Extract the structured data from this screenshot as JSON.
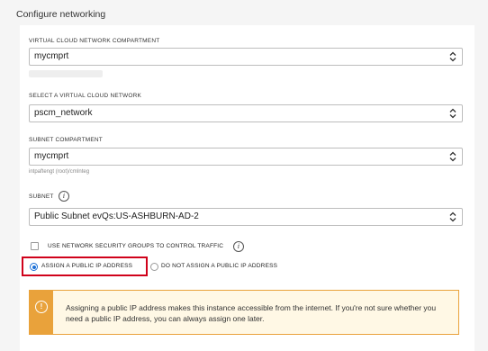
{
  "section": {
    "title": "Configure networking"
  },
  "vcn_compartment": {
    "label": "VIRTUAL CLOUD NETWORK COMPARTMENT",
    "value": "mycmprt"
  },
  "vcn": {
    "label": "SELECT A VIRTUAL CLOUD NETWORK",
    "value": "pscm_network"
  },
  "subnet_compartment": {
    "label": "SUBNET COMPARTMENT",
    "value": "mycmprt",
    "hint": "intpaftengt (root)/cmInteg"
  },
  "subnet": {
    "label": "SUBNET",
    "value": "Public Subnet evQs:US-ASHBURN-AD-2"
  },
  "nsg": {
    "label": "USE NETWORK SECURITY GROUPS TO CONTROL TRAFFIC",
    "checked": false
  },
  "public_ip": {
    "assign_label": "ASSIGN A PUBLIC IP ADDRESS",
    "no_assign_label": "DO NOT ASSIGN A PUBLIC IP ADDRESS",
    "selected": "assign"
  },
  "alert": {
    "text": "Assigning a public IP address makes this instance accessible from the internet. If you're not sure whether you need a public IP address, you can always assign one later.",
    "icon": "warning-icon"
  },
  "colors": {
    "accent": "#1a6fd6",
    "highlight": "#d0021b",
    "warning": "#e9a23b"
  }
}
